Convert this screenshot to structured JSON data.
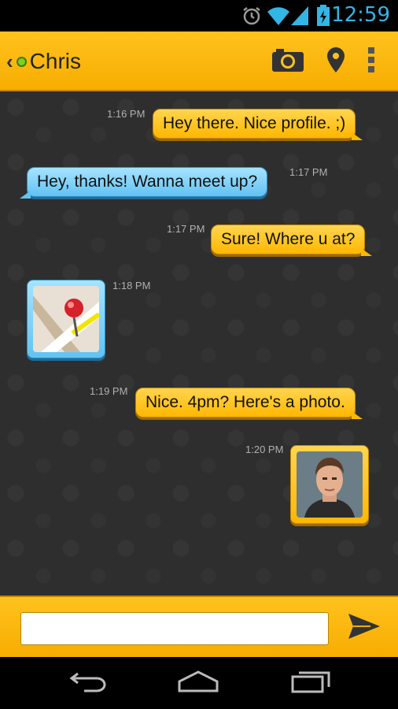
{
  "status_bar": {
    "time": "12:59"
  },
  "header": {
    "contact_name": "Chris",
    "online": true
  },
  "messages": [
    {
      "direction": "out",
      "type": "text",
      "text": "Hey there. Nice profile. ;)",
      "time": "1:16 PM"
    },
    {
      "direction": "in",
      "type": "text",
      "text": "Hey, thanks! Wanna meet up?",
      "time": "1:17 PM"
    },
    {
      "direction": "out",
      "type": "text",
      "text": "Sure! Where u at?",
      "time": "1:17 PM"
    },
    {
      "direction": "in",
      "type": "location",
      "time": "1:18 PM"
    },
    {
      "direction": "out",
      "type": "text",
      "text": "Nice. 4pm? Here's a photo.",
      "time": "1:19 PM"
    },
    {
      "direction": "out",
      "type": "photo",
      "time": "1:20 PM"
    }
  ],
  "composer": {
    "value": "",
    "placeholder": ""
  },
  "icons": {
    "back": "chevron-left-icon",
    "camera": "camera-icon",
    "location": "map-pin-icon",
    "overflow": "overflow-menu-icon",
    "send": "send-icon",
    "nav_back": "nav-back-icon",
    "nav_home": "nav-home-icon",
    "nav_recents": "nav-recents-icon"
  },
  "colors": {
    "accent": "#ffb700",
    "incoming": "#62c2f2",
    "status_blue": "#33b5e5",
    "online": "#7ad21e"
  }
}
